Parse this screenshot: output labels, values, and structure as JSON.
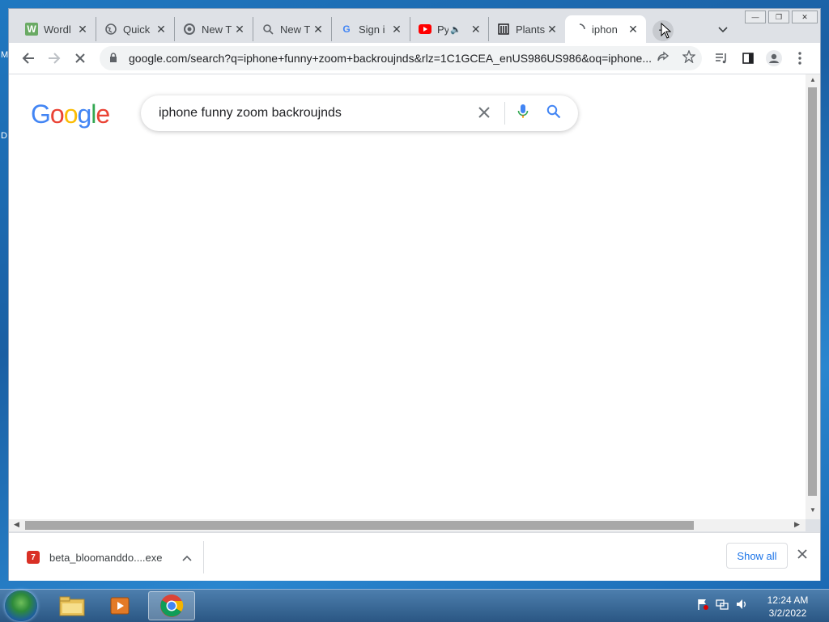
{
  "desktop": {
    "edge_letters": [
      "M",
      "D"
    ]
  },
  "browser": {
    "tabs": [
      {
        "label": "Wordl",
        "icon": "wordle-w-icon"
      },
      {
        "label": "Quick",
        "icon": "globe-icon"
      },
      {
        "label": "New T",
        "icon": "chrome-icon"
      },
      {
        "label": "New T",
        "icon": "search-icon"
      },
      {
        "label": "Sign i",
        "icon": "google-g-icon"
      },
      {
        "label": "Py",
        "icon": "youtube-icon"
      },
      {
        "label": "Plants",
        "icon": "building-icon"
      },
      {
        "label": "iphon",
        "icon": "loading-spinner-icon"
      }
    ],
    "address": "google.com/search?q=iphone+funny+zoom+backroujnds&rlz=1C1GCEA_enUS986US986&oq=iphone..."
  },
  "page": {
    "logo": [
      "G",
      "o",
      "o",
      "g",
      "l",
      "e"
    ],
    "logo_colors": [
      "#4285F4",
      "#EA4335",
      "#FBBC05",
      "#4285F4",
      "#34A853",
      "#EA4335"
    ],
    "query": "iphone funny zoom backroujnds"
  },
  "downloads": {
    "file": "beta_bloomanddo....exe",
    "show_all": "Show all"
  },
  "taskbar": {
    "time": "12:24 AM",
    "date": "3/2/2022"
  }
}
